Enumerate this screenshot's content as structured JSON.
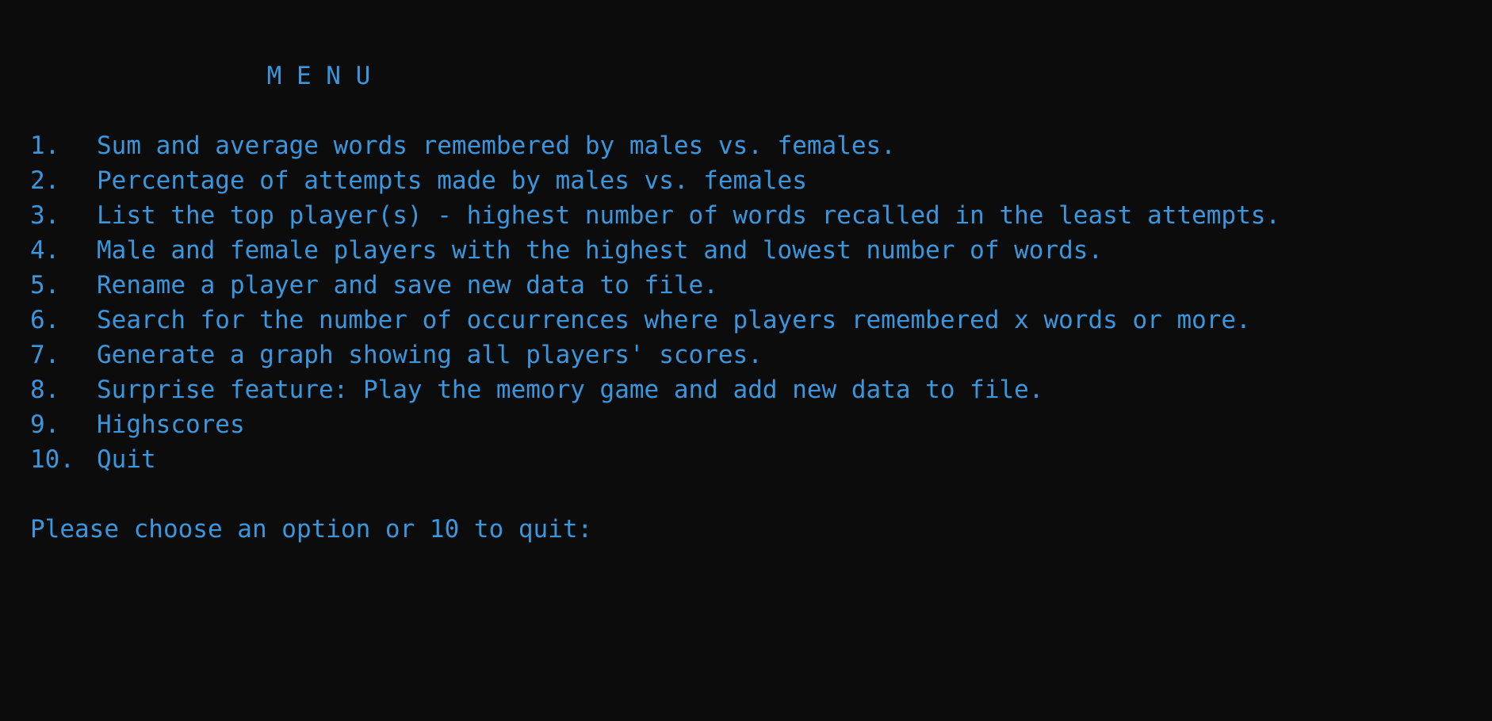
{
  "console": {
    "title": "                M E N U",
    "items": [
      {
        "number": "1.",
        "label": "Sum and average words remembered by males vs. females."
      },
      {
        "number": "2.",
        "label": "Percentage of attempts made by males vs. females"
      },
      {
        "number": "3.",
        "label": "List the top player(s) - highest number of words recalled in the least attempts."
      },
      {
        "number": "4.",
        "label": "Male and female players with the highest and lowest number of words."
      },
      {
        "number": "5.",
        "label": "Rename a player and save new data to file."
      },
      {
        "number": "6.",
        "label": "Search for the number of occurrences where players remembered x words or more."
      },
      {
        "number": "7.",
        "label": "Generate a graph showing all players' scores."
      },
      {
        "number": "8.",
        "label": "Surprise feature: Play the memory game and add new data to file."
      },
      {
        "number": "9.",
        "label": "Highscores"
      },
      {
        "number": "10.",
        "label": "Quit"
      }
    ],
    "prompt": "Please choose an option or 10 to quit:"
  },
  "colors": {
    "background": "#0c0c0c",
    "text": "#3a96dd"
  }
}
